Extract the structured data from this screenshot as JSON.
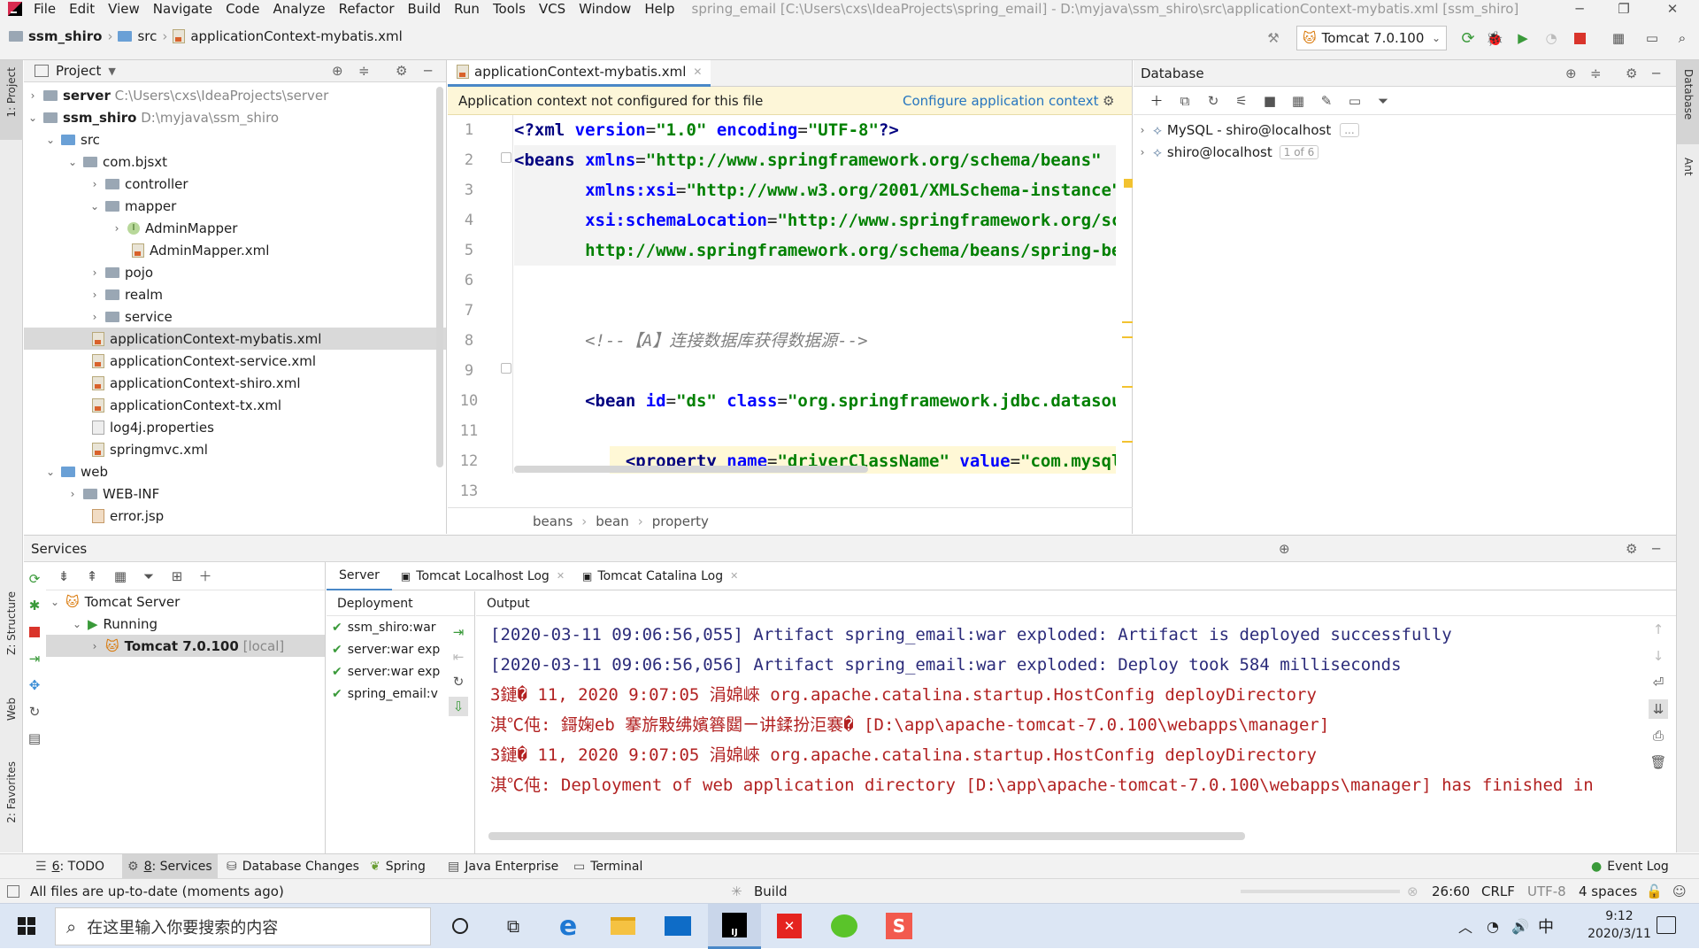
{
  "window": {
    "title": "spring_email [C:\\Users\\cxs\\IdeaProjects\\spring_email] - D:\\myjava\\ssm_shiro\\src\\applicationContext-mybatis.xml [ssm_shiro]"
  },
  "menu": [
    "File",
    "Edit",
    "View",
    "Navigate",
    "Code",
    "Analyze",
    "Refactor",
    "Build",
    "Run",
    "Tools",
    "VCS",
    "Window",
    "Help"
  ],
  "breadcrumb": [
    "ssm_shiro",
    "src",
    "applicationContext-mybatis.xml"
  ],
  "run_config": "Tomcat 7.0.100",
  "left_stripe": {
    "project": "1: Project",
    "structure": "Z: Structure",
    "web": "Web",
    "favorites": "2: Favorites"
  },
  "right_stripe": {
    "database": "Database",
    "ant": "Ant"
  },
  "project": {
    "title": "Project",
    "tree": [
      {
        "label": "server",
        "path": "C:\\Users\\cxs\\IdeaProjects\\server"
      },
      {
        "label": "ssm_shiro",
        "path": "D:\\myjava\\ssm_shiro"
      },
      {
        "label": "src"
      },
      {
        "label": "com.bjsxt"
      },
      {
        "label": "controller"
      },
      {
        "label": "mapper"
      },
      {
        "label": "AdminMapper"
      },
      {
        "label": "AdminMapper.xml"
      },
      {
        "label": "pojo"
      },
      {
        "label": "realm"
      },
      {
        "label": "service"
      },
      {
        "label": "applicationContext-mybatis.xml"
      },
      {
        "label": "applicationContext-service.xml"
      },
      {
        "label": "applicationContext-shiro.xml"
      },
      {
        "label": "applicationContext-tx.xml"
      },
      {
        "label": "log4j.properties"
      },
      {
        "label": "springmvc.xml"
      },
      {
        "label": "web"
      },
      {
        "label": "WEB-INF"
      },
      {
        "label": "error.jsp"
      }
    ]
  },
  "editor": {
    "tab": "applicationContext-mybatis.xml",
    "banner": "Application context not configured for this file",
    "banner_link": "Configure application context",
    "line_numbers": [
      "1",
      "2",
      "3",
      "4",
      "5",
      "6",
      "7",
      "8",
      "9",
      "10",
      "11",
      "12",
      "13"
    ],
    "breadcrumb": [
      "beans",
      "bean",
      "property"
    ]
  },
  "database": {
    "title": "Database",
    "items": [
      {
        "label": "MySQL - shiro@localhost",
        "badge": "..."
      },
      {
        "label": "shiro@localhost",
        "badge": "1 of 6"
      }
    ]
  },
  "services": {
    "title": "Services",
    "tree": [
      {
        "label": "Tomcat Server"
      },
      {
        "label": "Running"
      },
      {
        "label": "Tomcat 7.0.100",
        "extra": "[local]"
      }
    ],
    "tabs": [
      "Server",
      "Tomcat Localhost Log",
      "Tomcat Catalina Log"
    ],
    "deployment_label": "Deployment",
    "output_label": "Output",
    "deployments": [
      "ssm_shiro:war",
      "server:war exp",
      "server:war exp",
      "spring_email:v"
    ],
    "output": [
      "[2020-03-11 09:06:56,055] Artifact spring_email:war exploded: Artifact is deployed successfully",
      "[2020-03-11 09:06:56,056] Artifact spring_email:war exploded: Deploy took 584 milliseconds",
      "3鏈� 11, 2020 9:07:05 涓婂崍 org.apache.catalina.startup.HostConfig deployDirectory",
      "淇℃伅: 鎶婅eb 搴旂敤绋嬪簭閮ㄧ讲鍒扮洰褰� [D:\\app\\apache-tomcat-7.0.100\\webapps\\manager]",
      "3鏈� 11, 2020 9:07:05 涓婂崍 org.apache.catalina.startup.HostConfig deployDirectory",
      "淇℃伅: Deployment of web application directory [D:\\app\\apache-tomcat-7.0.100\\webapps\\manager] has finished in"
    ]
  },
  "tool_windows": [
    {
      "key": "6",
      "label": ": TODO"
    },
    {
      "key": "8",
      "label": ": Services"
    },
    {
      "key": "",
      "label": "Database Changes"
    },
    {
      "key": "",
      "label": "Spring"
    },
    {
      "key": "",
      "label": "Java Enterprise"
    },
    {
      "key": "",
      "label": "Terminal"
    }
  ],
  "event_log": "Event Log",
  "status": {
    "message": "All files are up-to-date (moments ago)",
    "build": "Build",
    "position": "26:60",
    "line_sep": "CRLF",
    "encoding": "UTF-8",
    "indent": "4 spaces"
  },
  "taskbar": {
    "search_placeholder": "在这里输入你要搜索的内容",
    "ime": "中",
    "time": "9:12",
    "date": "2020/3/11"
  },
  "colors": {
    "accent": "#2675bf",
    "running": "#3a9a3a",
    "error": "#b22222",
    "banner": "#fdf6d8"
  }
}
